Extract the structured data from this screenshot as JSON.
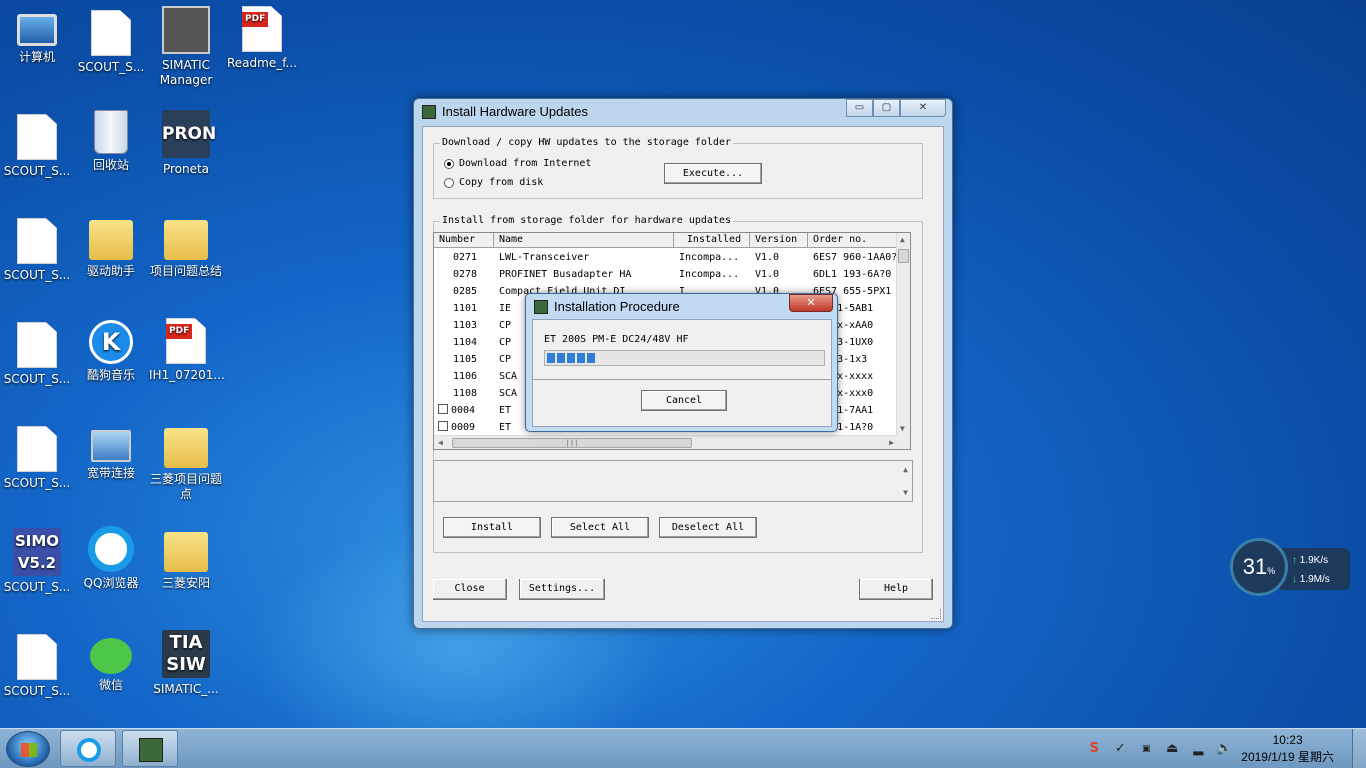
{
  "desktop": {
    "icons": [
      {
        "label": "计算机"
      },
      {
        "label": "SCOUT_S..."
      },
      {
        "label": "SIMATIC Manager"
      },
      {
        "label": "Readme_f..."
      },
      {
        "label": "SCOUT_S..."
      },
      {
        "label": "回收站"
      },
      {
        "label": "Proneta",
        "tile_text": "PRON"
      },
      {
        "label": "SCOUT_S..."
      },
      {
        "label": "驱动助手"
      },
      {
        "label": "项目问题总结"
      },
      {
        "label": "SCOUT_S..."
      },
      {
        "label": "酷狗音乐",
        "tile_text": "K"
      },
      {
        "label": "IH1_07201..."
      },
      {
        "label": "SCOUT_S..."
      },
      {
        "label": "宽带连接"
      },
      {
        "label": "三菱项目问题点"
      },
      {
        "label": "SCOUT_S...",
        "tile_text": "SIMO V5.2"
      },
      {
        "label": "QQ浏览器"
      },
      {
        "label": "三菱安阳"
      },
      {
        "label": "SCOUT_S..."
      },
      {
        "label": "微信"
      },
      {
        "label": "SIMATIC_...",
        "tile_text": "TIA SIW"
      }
    ],
    "pdf_badge": "PDF"
  },
  "window": {
    "title": "Install Hardware Updates",
    "caption": {
      "minimize": "▭",
      "maximize": "▢",
      "close": "✕"
    },
    "download_group": {
      "label": "Download / copy HW updates to the storage folder",
      "options": [
        "Download from Internet",
        "Copy from disk"
      ],
      "selected_index": 0,
      "execute_button": "Execute..."
    },
    "install_group": {
      "label": "Install from storage folder for hardware updates",
      "columns": [
        "Number",
        "Name",
        "Installed",
        "Version",
        "Order no."
      ],
      "rows": [
        {
          "number": "0271",
          "name": "LWL-Transceiver",
          "installed": "Incompa...",
          "version": "V1.0",
          "order": "6ES7 960-1AA0?",
          "checkbox": false
        },
        {
          "number": "0278",
          "name": "PROFINET Busadapter HA",
          "installed": "Incompa...",
          "version": "V1.0",
          "order": "6DL1 193-6A?0",
          "checkbox": false
        },
        {
          "number": "0285",
          "name": "Compact Field Unit DI",
          "installed": "I",
          "version": "V1.0",
          "order": "6ES7 655-5PX1",
          "checkbox": false
        },
        {
          "number": "1101",
          "name": "IE",
          "installed": "",
          "version": "",
          "order": "1 411-5AB1",
          "checkbox": false
        },
        {
          "number": "1103",
          "name": "CP",
          "installed": "",
          "version": "",
          "order": "1 16x-xAA0",
          "checkbox": false
        },
        {
          "number": "1104",
          "name": "CP",
          "installed": "",
          "version": "",
          "order": "7 443-1UX0",
          "checkbox": false
        },
        {
          "number": "1105",
          "name": "CP",
          "installed": "",
          "version": "",
          "order": "7 443-1x3",
          "checkbox": false
        },
        {
          "number": "1106",
          "name": "SCA",
          "installed": "",
          "version": "",
          "order": "5 2xx-xxxx",
          "checkbox": false
        },
        {
          "number": "1108",
          "name": "SCA",
          "installed": "",
          "version": "",
          "order": "5 xxx-xxx0",
          "checkbox": false
        },
        {
          "number": "0004",
          "name": "ET",
          "installed": "",
          "version": "",
          "order": "7 151-7AA1",
          "checkbox": true
        },
        {
          "number": "0009",
          "name": "ET",
          "installed": "",
          "version": "",
          "order": "7 151-1A?0",
          "checkbox": true
        }
      ],
      "scroll_thumb_glyph": "|||",
      "install_button": "Install",
      "select_all_button": "Select All",
      "deselect_all_button": "Deselect All"
    },
    "footer": {
      "close_button": "Close",
      "settings_button": "Settings...",
      "help_button": "Help"
    }
  },
  "dialog": {
    "title": "Installation Procedure",
    "close_glyph": "✕",
    "item": "ET 200S PM-E DC24/48V HF",
    "progress_percent": 18,
    "progress_segments": 5,
    "cancel_button": "Cancel"
  },
  "speed_widget": {
    "percent": "31",
    "percent_unit": "%",
    "up": "1.9K/s",
    "down": "1.9M/s"
  },
  "taskbar": {
    "time": "10:23",
    "date": "2019/1/19 星期六"
  },
  "colors": {
    "desktop_blue": "#1366c8",
    "progress_blue": "#2f7fd8",
    "window_frame": "#bcd6ee"
  }
}
